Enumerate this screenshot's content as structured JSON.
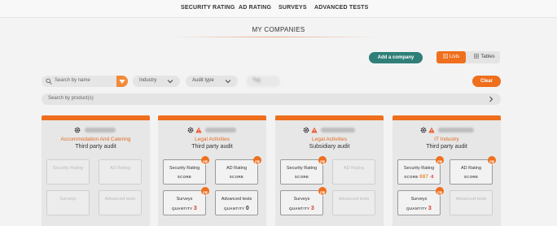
{
  "topnav": {
    "items": [
      "SECURITY RATING",
      "AD RATING",
      "SURVEYS",
      "ADVANCED TESTS"
    ]
  },
  "page": {
    "title": "MY COMPANIES"
  },
  "toolbar": {
    "add_company": "Add a company",
    "view_lists": "Lists",
    "view_tables": "Tables"
  },
  "filters": {
    "search_placeholder": "Search by name",
    "industry": "Industry",
    "audit_type": "Audit type",
    "tag": "Tag",
    "clear": "Clear",
    "product_search_placeholder": "Search by product(s)"
  },
  "tile_labels": {
    "security_rating": "Security Rating",
    "ad_rating": "AD Rating",
    "surveys": "Surveys",
    "advanced_tests": "Advanced tests",
    "score": "SCORE",
    "quantity": "QUANTITY"
  },
  "cards": [
    {
      "industry": "Accommodation And Catering",
      "audit_type": "Third party audit",
      "warning": false,
      "surveys_qty": "",
      "advanced_qty": "",
      "score": ""
    },
    {
      "industry": "Legal Activities",
      "audit_type": "Third party audit",
      "warning": true,
      "surveys_qty": "3",
      "advanced_qty": "0",
      "score": ""
    },
    {
      "industry": "Legal Activities",
      "audit_type": "Subsidiary audit",
      "warning": true,
      "surveys_qty": "3",
      "advanced_qty": "",
      "score": ""
    },
    {
      "industry": "IT Industry",
      "audit_type": "Third party audit",
      "warning": true,
      "surveys_qty": "3",
      "advanced_qty": "",
      "score": "687",
      "score_delta": "-6"
    }
  ],
  "colors": {
    "accent": "#ee6f1d",
    "add_button": "#2f7e78",
    "warning": "#e8542a"
  }
}
